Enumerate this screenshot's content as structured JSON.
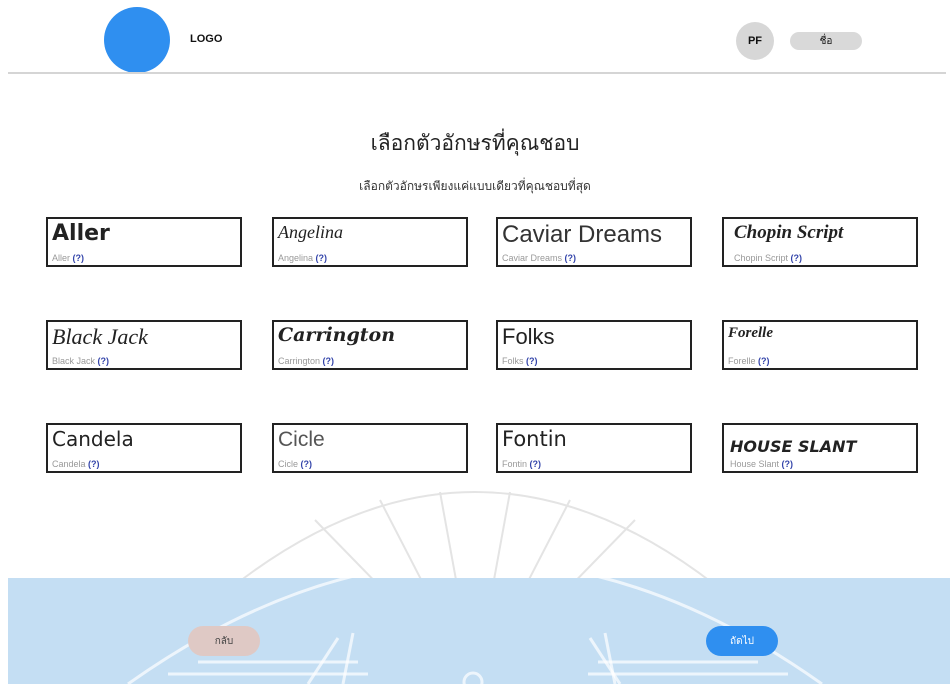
{
  "header": {
    "logo_label": "LOGO",
    "avatar_initials": "PF",
    "name_label": "ชื่อ"
  },
  "main": {
    "title": "เลือกตัวอักษรที่คุณชอบ",
    "subtitle": "เลือกตัวอักษรเพียงแค่แบบเดียวที่คุณชอบที่สุด",
    "help_mark": "(?)",
    "fonts": [
      {
        "sample": "Aller",
        "caption": "Aller"
      },
      {
        "sample": "Angelina",
        "caption": "Angelina"
      },
      {
        "sample": "Caviar Dreams",
        "caption": "Caviar Dreams"
      },
      {
        "sample": "Chopin Script",
        "caption": "Chopin Script"
      },
      {
        "sample": "Black Jack",
        "caption": "Black Jack"
      },
      {
        "sample": "Carrington",
        "caption": "Carrington"
      },
      {
        "sample": "Folks",
        "caption": "Folks"
      },
      {
        "sample": "Forelle",
        "caption": "Forelle"
      },
      {
        "sample": "Candela",
        "caption": "Candela"
      },
      {
        "sample": "Cicle",
        "caption": "Cicle"
      },
      {
        "sample": "Fontin",
        "caption": "Fontin"
      },
      {
        "sample": "HOUSE SLANT",
        "caption": "House Slant"
      }
    ]
  },
  "footer": {
    "back_label": "กลับ",
    "next_label": "ถัดไป"
  },
  "colors": {
    "accent": "#2f8ff0",
    "footer_bg": "#c4def3",
    "back_button": "#dfc9c5",
    "help_link": "#3344aa"
  }
}
